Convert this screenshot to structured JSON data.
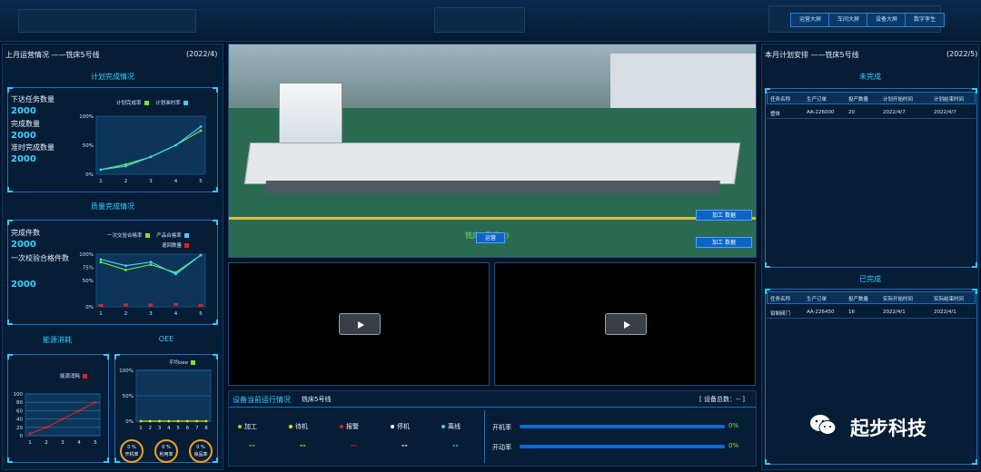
{
  "nav": [
    "运营大屏",
    "车间大屏",
    "设备大屏",
    "数字孪生"
  ],
  "left": {
    "title": "上月运营情况 ——铣床5号线",
    "date": "(2022/4)",
    "plan": {
      "section_title": "计划完成情况",
      "stats": [
        {
          "label": "下达任务数量",
          "value": "2000"
        },
        {
          "label": "完成数量",
          "value": "2000"
        },
        {
          "label": "准时完成数量",
          "value": "2000"
        }
      ],
      "legend": [
        "计划完成率",
        "计划准时率"
      ],
      "legend_colors": [
        "#7ee23b",
        "#3fd0ff"
      ]
    },
    "quality": {
      "section_title": "质量完成情况",
      "stats": [
        {
          "label": "完成件数",
          "value": "2000"
        },
        {
          "label": "一次校验合格件数",
          "value": "2000"
        }
      ],
      "legend": [
        "一次交验合格率",
        "产品合格率",
        "退回数量"
      ],
      "legend_colors": [
        "#7ee23b",
        "#3fd0ff",
        "#e02020"
      ]
    },
    "energy": {
      "section_title": "能源消耗",
      "legend": "能源消耗",
      "legend_color": "#e02020"
    },
    "oee": {
      "section_title": "OEE",
      "legend": "平均oee",
      "legend_color": "#7ee23b",
      "gauges": [
        {
          "value": "0 %",
          "label": "开机率"
        },
        {
          "value": "0 %",
          "label": "利用率"
        },
        {
          "value": "0 %",
          "label": "良品率"
        }
      ]
    }
  },
  "center": {
    "scene_caption": "铣床5号线(2)",
    "scene_button": "运营",
    "overlay_buttons": [
      "加工 数据",
      "加工 数据"
    ],
    "status": {
      "title": "设备当前运行情况",
      "line": "铣床5号线",
      "count": "[ 设备总数：-- ]",
      "items": [
        {
          "label": "加工",
          "value": "--",
          "color": "#7ee23b"
        },
        {
          "label": "待机",
          "value": "--",
          "color": "#f2e020"
        },
        {
          "label": "报警",
          "value": "--",
          "color": "#e02020"
        },
        {
          "label": "停机",
          "value": "--",
          "color": "#ffffff"
        },
        {
          "label": "离线",
          "value": "--",
          "color": "#3fd0ff"
        }
      ],
      "bars": [
        {
          "label": "开机率",
          "value": "0%",
          "fraction": 0
        },
        {
          "label": "开动率",
          "value": "0%",
          "fraction": 0
        }
      ]
    }
  },
  "right": {
    "title": "本月计划安排 ——铣床5号线",
    "date": "(2022/5)",
    "pending": {
      "section_title": "未完成",
      "headers": [
        "任务名称",
        "生产订单",
        "投产数量",
        "计划开始时间",
        "计划结束时间"
      ],
      "rows": [
        [
          "塑体",
          "AA-226000",
          "20",
          "2022/4/7",
          "2022/4/7"
        ]
      ]
    },
    "done": {
      "section_title": "已完成",
      "headers": [
        "任务名称",
        "生产订单",
        "投产数量",
        "实际开始时间",
        "实际结束时间"
      ],
      "rows": [
        [
          "钳制阀门",
          "AA-226450",
          "16",
          "2022/4/1",
          "2022/4/1"
        ]
      ]
    }
  },
  "watermark": "起步科技",
  "chart_data": [
    {
      "type": "line",
      "x": [
        1,
        2,
        3,
        4,
        5
      ],
      "ylim": [
        0,
        100
      ],
      "yticks": [
        "0%",
        "50%",
        "100%"
      ],
      "series": [
        {
          "name": "计划完成率",
          "values": [
            8,
            17,
            30,
            50,
            75
          ],
          "color": "#7ee23b"
        },
        {
          "name": "计划准时率",
          "values": [
            8,
            14,
            30,
            50,
            82
          ],
          "color": "#3fd0ff"
        }
      ]
    },
    {
      "type": "line",
      "x": [
        1,
        2,
        3,
        4,
        5
      ],
      "ylim": [
        0,
        100
      ],
      "yticks": [
        "0%",
        "50%",
        "75%",
        "100%"
      ],
      "series": [
        {
          "name": "一次交验合格率",
          "values": [
            85,
            70,
            80,
            65,
            98
          ],
          "color": "#7ee23b"
        },
        {
          "name": "产品合格率",
          "values": [
            90,
            78,
            85,
            62,
            98
          ],
          "color": "#3fd0ff"
        },
        {
          "name": "退回数量",
          "values": [
            0,
            1,
            1,
            2,
            0
          ],
          "color": "#e02020"
        }
      ]
    },
    {
      "type": "line",
      "x": [
        1,
        2,
        3,
        4,
        5
      ],
      "ylim": [
        0,
        100
      ],
      "yticks": [
        "0",
        "20",
        "40",
        "60",
        "80",
        "100"
      ],
      "series": [
        {
          "name": "能源消耗",
          "values": [
            5,
            20,
            40,
            60,
            80
          ],
          "color": "#e02020"
        }
      ]
    },
    {
      "type": "line",
      "x": [
        1,
        2,
        3,
        4,
        5,
        6,
        7,
        8
      ],
      "ylim": [
        0,
        100
      ],
      "yticks": [
        "0%",
        "50%",
        "100%"
      ],
      "series": [
        {
          "name": "平均oee",
          "values": [
            0,
            0,
            0,
            0,
            0,
            0,
            0,
            0
          ],
          "color": "#e8e020"
        }
      ]
    }
  ]
}
